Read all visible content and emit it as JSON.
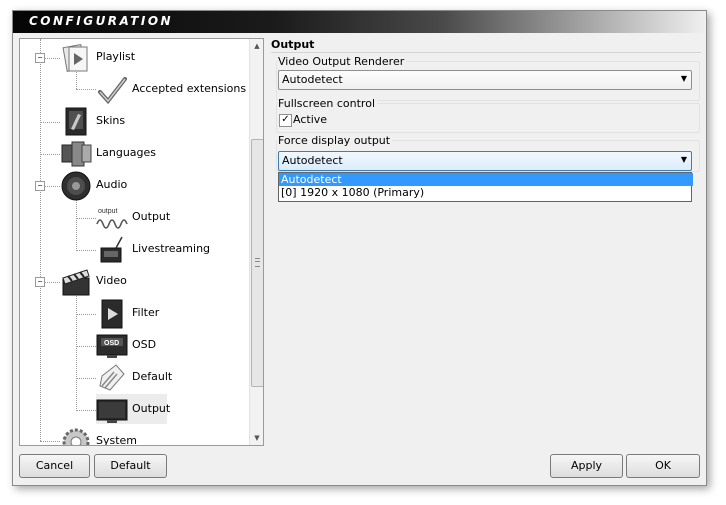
{
  "window": {
    "title": "CONFIGURATION"
  },
  "tree": {
    "items": [
      {
        "label": "Playlist",
        "icon": "playlist-icon"
      },
      {
        "label": "Accepted extensions",
        "icon": "checkmark-icon"
      },
      {
        "label": "Skins",
        "icon": "skins-icon"
      },
      {
        "label": "Languages",
        "icon": "languages-icon"
      },
      {
        "label": "Audio",
        "icon": "speaker-icon"
      },
      {
        "label": "Output",
        "icon": "audio-output-icon"
      },
      {
        "label": "Livestreaming",
        "icon": "livestreaming-icon"
      },
      {
        "label": "Video",
        "icon": "clapperboard-icon"
      },
      {
        "label": "Filter",
        "icon": "filter-icon"
      },
      {
        "label": "OSD",
        "icon": "osd-icon"
      },
      {
        "label": "Default",
        "icon": "default-icon"
      },
      {
        "label": "Output",
        "icon": "video-output-icon"
      },
      {
        "label": "System",
        "icon": "gear-icon"
      }
    ],
    "selected_index": 11,
    "osd_icon_text": "OSD",
    "output_icon_text": "output"
  },
  "panel": {
    "header": "Output",
    "video_renderer": {
      "label": "Video Output Renderer",
      "value": "Autodetect"
    },
    "fullscreen": {
      "label": "Fullscreen control",
      "checkbox_label": "Active",
      "checked": true
    },
    "force_display": {
      "label": "Force display output",
      "value": "Autodetect",
      "options": [
        "Autodetect",
        "[0]  1920 x 1080 (Primary)"
      ],
      "selected_index": 0
    }
  },
  "buttons": {
    "cancel": "Cancel",
    "default": "Default",
    "apply": "Apply",
    "ok": "OK"
  },
  "colors": {
    "selection": "#3399ff",
    "title_bar": "#1b1b1b",
    "tree_background": "#ffffff"
  }
}
